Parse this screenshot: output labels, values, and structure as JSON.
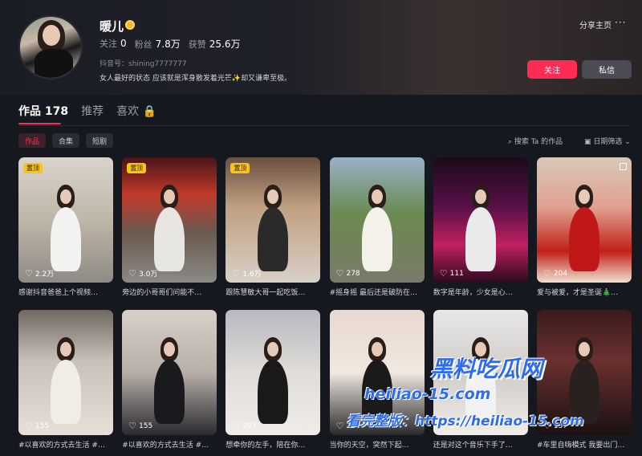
{
  "profile": {
    "name": "暖儿",
    "following_label": "关注",
    "following_value": "0",
    "followers_label": "粉丝",
    "followers_value": "7.8万",
    "likes_label": "获赞",
    "likes_value": "25.6万",
    "douyin_id": "抖音号：shining7777777",
    "bio": "女人最好的状态 应该就是浑身散发着光芒✨却又谦卑至极。",
    "share_label": "分享主页",
    "more_label": "···",
    "follow_button": "关注",
    "message_button": "私信"
  },
  "tabs": [
    {
      "label": "作品 178"
    },
    {
      "label": "推荐"
    },
    {
      "label": "喜欢 🔒"
    }
  ],
  "filters": {
    "chips": [
      "作品",
      "合集",
      "短剧"
    ],
    "search_label": "搜索 Ta 的作品",
    "date_filter_label": "日期筛选"
  },
  "pinned_label": "置顶",
  "videos": [
    {
      "likes": "2.2万",
      "title": "感谢抖音爸爸上个视频…"
    },
    {
      "likes": "3.0万",
      "title": "旁边的小哥哥们问能不…"
    },
    {
      "likes": "1.6万",
      "title": "跟陈慧敏大哥一起吃饭…"
    },
    {
      "likes": "278",
      "title": "#摇身摇 最后还是破防在…"
    },
    {
      "likes": "111",
      "title": "数字是年龄，少女是心…"
    },
    {
      "likes": "204",
      "title": "爱与被爱，才是圣诞🎄…"
    },
    {
      "likes": "155",
      "title": "#以喜欢的方式去生活 #…"
    },
    {
      "likes": "155",
      "title": "#以喜欢的方式去生活 #…"
    },
    {
      "likes": "207",
      "title": "想牵你的左手，陪在你…"
    },
    {
      "likes": "22",
      "title": "当你的天空，突然下起…"
    },
    {
      "likes": "194",
      "title": "还是对这个音乐下手了…"
    },
    {
      "likes": "137",
      "title": "#车里自嗨模式 我要出门…"
    }
  ],
  "watermark": {
    "line1": "黑料吃瓜网",
    "line2": "heiliao-15.com",
    "line3": "看完整版：https://heiliao-15.com"
  },
  "colors": {
    "accent": "#fe2c55",
    "background": "#16181f",
    "pin": "#fac31a",
    "watermark": "#2d6cf0"
  }
}
